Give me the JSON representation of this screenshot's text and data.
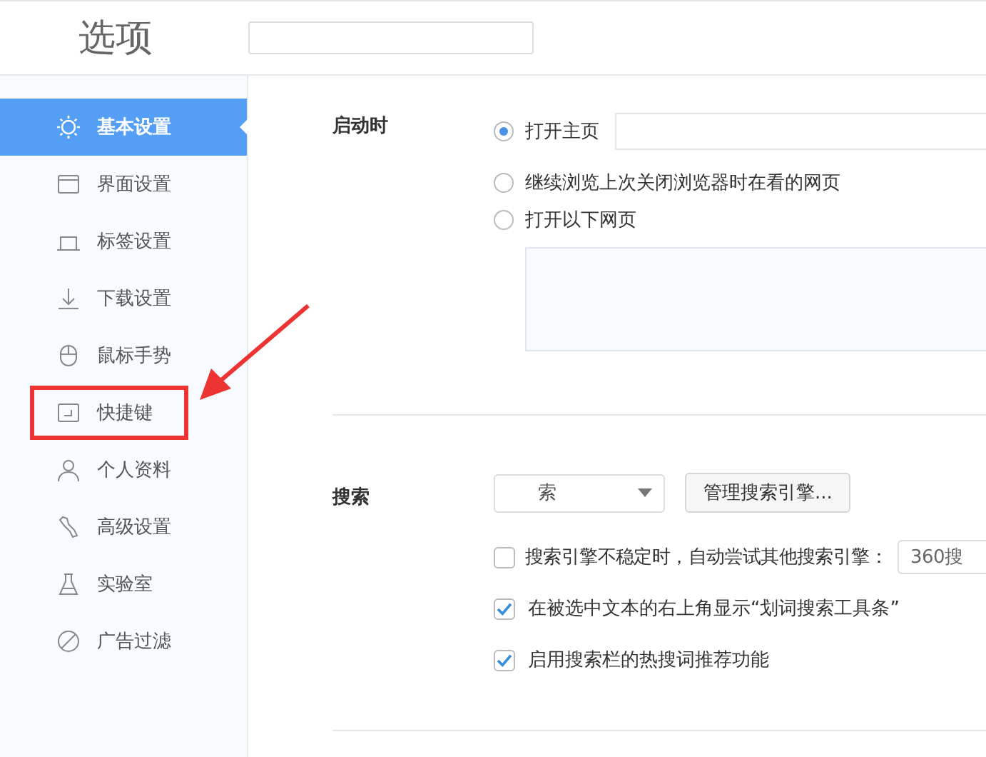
{
  "header": {
    "title": "选项"
  },
  "sidebar": {
    "items": [
      {
        "label": "基本设置",
        "selected": true,
        "highlighted": false
      },
      {
        "label": "界面设置",
        "selected": false,
        "highlighted": false
      },
      {
        "label": "标签设置",
        "selected": false,
        "highlighted": false
      },
      {
        "label": "下载设置",
        "selected": false,
        "highlighted": false
      },
      {
        "label": "鼠标手势",
        "selected": false,
        "highlighted": false
      },
      {
        "label": "快捷键",
        "selected": false,
        "highlighted": true
      },
      {
        "label": "个人资料",
        "selected": false,
        "highlighted": false
      },
      {
        "label": "高级设置",
        "selected": false,
        "highlighted": false
      },
      {
        "label": "实验室",
        "selected": false,
        "highlighted": false
      },
      {
        "label": "广告过滤",
        "selected": false,
        "highlighted": false
      }
    ]
  },
  "startup": {
    "label": "启动时",
    "options": [
      {
        "label": "打开主页",
        "selected": true
      },
      {
        "label": "继续浏览上次关闭浏览器时在看的网页",
        "selected": false
      },
      {
        "label": "打开以下网页",
        "selected": false
      }
    ]
  },
  "search": {
    "label": "搜索",
    "engine_value": "索",
    "manage_button": "管理搜索引擎...",
    "options": [
      {
        "label": "搜索引擎不稳定时，自动尝试其他搜索引擎：",
        "checked": false,
        "fallback": "360搜"
      },
      {
        "label": "在被选中文本的右上角显示“划词搜索工具条”",
        "checked": true
      },
      {
        "label": "启用搜索栏的热搜词推荐功能",
        "checked": true
      }
    ]
  },
  "annotation": {
    "kind": "arrow"
  }
}
